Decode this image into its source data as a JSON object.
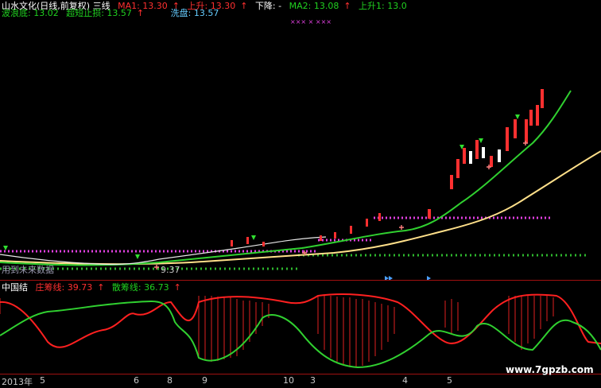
{
  "header": {
    "stock_title": "山水文化(日线,前复权) 三线",
    "ma1_label": "MA1: 13.30",
    "rise_label": "上升: 13.30",
    "fall_label": "下降: -",
    "ma2_label": "MA2: 13.08",
    "rise1_label": "上升1: 13.0",
    "wave_bottom_label": "波浪底: 13.02",
    "super_stop_label": "超短止损: 13.57",
    "wash_label": "洗盘: 13.57",
    "marker_strip": "×××  ×   ×××"
  },
  "main_chart": {
    "bottom_note": "用到未来数据",
    "price_note": "9.37"
  },
  "indicator": {
    "name": "中国结",
    "zhuang_label": "庄筹线: 39.73",
    "san_label": "散筹线: 36.73"
  },
  "date_axis": {
    "year_label": "2013年",
    "ticks": [
      "5",
      "6",
      "8",
      "9",
      "10",
      "3",
      "4",
      "5"
    ]
  },
  "watermark": "www.7gpzb.com",
  "colors": {
    "up": "#ff3030",
    "green": "#20d020",
    "yellow": "#ffe08a",
    "magenta": "#e040e0",
    "divider": "#a01010"
  },
  "chart_data": {
    "type": "line",
    "title": "",
    "xlabel": "",
    "ylabel": "",
    "series": [
      {
        "name": "MA1",
        "values": [
          8.6,
          8.7,
          8.8,
          9.0,
          9.2,
          9.5,
          9.9,
          10.4,
          11.2,
          12.1,
          13.3
        ]
      },
      {
        "name": "MA2",
        "values": [
          8.5,
          8.55,
          8.6,
          8.7,
          8.85,
          9.0,
          9.3,
          9.8,
          10.6,
          11.8,
          13.08
        ]
      }
    ]
  }
}
